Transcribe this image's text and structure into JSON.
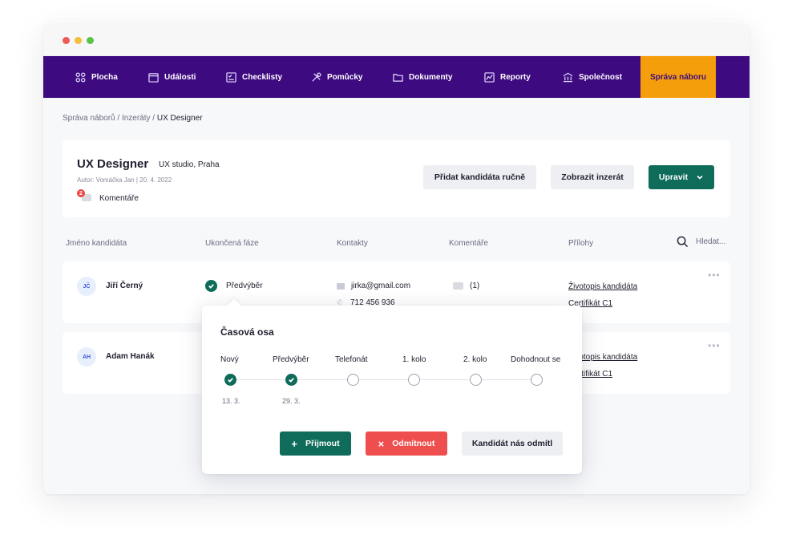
{
  "nav": {
    "items": [
      {
        "label": "Plocha",
        "icon": "dashboard-icon"
      },
      {
        "label": "Události",
        "icon": "calendar-icon"
      },
      {
        "label": "Checklisty",
        "icon": "checklist-icon"
      },
      {
        "label": "Pomůcky",
        "icon": "tools-icon"
      },
      {
        "label": "Dokumenty",
        "icon": "folder-icon"
      },
      {
        "label": "Reporty",
        "icon": "chart-icon"
      },
      {
        "label": "Společnost",
        "icon": "building-icon"
      },
      {
        "label": "Správa náboru",
        "active": true
      }
    ]
  },
  "breadcrumb": {
    "part1": "Správa náborů",
    "sep": " / ",
    "part2": "Inzeráty",
    "current": "UX Designer"
  },
  "job": {
    "title": "UX Designer",
    "company": "UX studio, Praha",
    "meta": "Autor:  Vomáčka Jan  |  20. 4. 2022",
    "comment_count": "2",
    "comments_label": "Komentáře",
    "add_candidate_label": "Přidat kandidáta ručně",
    "show_ad_label": "Zobrazit inzerát",
    "edit_label": "Upravit"
  },
  "table": {
    "headers": {
      "name": "Jméno kandidáta",
      "phase": "Ukončená fáze",
      "contacts": "Kontakty",
      "comments": "Komentáře",
      "attachments": "Přílohy",
      "search_placeholder": "Hledat..."
    },
    "rows": [
      {
        "initials": "JČ",
        "name": "Jiří Černý",
        "phase": "Předvýběr",
        "email": "jirka@gmail.com",
        "phone": "712 456 936",
        "comments": "(1)",
        "attachment1": "Životopis kandidáta",
        "attachment2": "Certifikát C1"
      },
      {
        "initials": "AH",
        "name": "Adam Hanák",
        "attachment1": "Životopis kandidáta",
        "attachment2": "Certifikát C1"
      }
    ]
  },
  "timeline": {
    "title": "Časová osa",
    "steps": [
      {
        "label": "Nový",
        "date": "13. 3.",
        "done": true
      },
      {
        "label": "Předvýběr",
        "date": "29. 3.",
        "done": true
      },
      {
        "label": "Telefonát",
        "done": false
      },
      {
        "label": "1. kolo",
        "done": false
      },
      {
        "label": "2. kolo",
        "done": false
      },
      {
        "label": "Dohodnout se",
        "done": false
      }
    ],
    "accept_label": "Přijmout",
    "reject_label": "Odmítnout",
    "declined_label": "Kandidát nás odmítl"
  },
  "colors": {
    "nav_bg": "#3d0a80",
    "active_tab": "#f59e0b",
    "primary": "#0f6b5a",
    "danger": "#ef4e4e"
  }
}
